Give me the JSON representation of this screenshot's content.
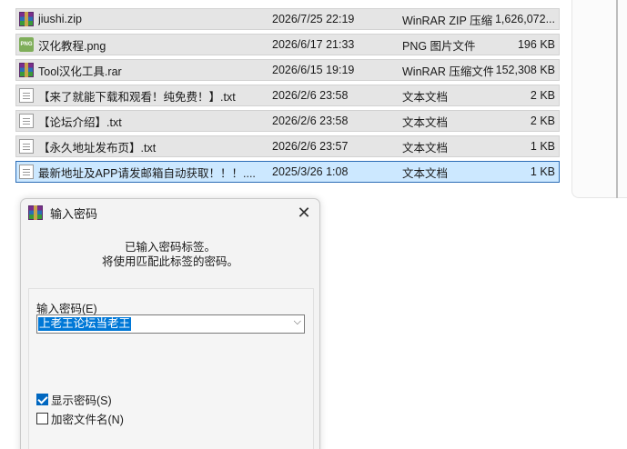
{
  "files": [
    {
      "name": "jiushi.zip",
      "date": "2026/7/25 22:19",
      "type": "WinRAR ZIP 压缩...",
      "size": "1,626,072...",
      "icon": "rar-archive-icon",
      "selected": false
    },
    {
      "name": "汉化教程.png",
      "date": "2026/6/17 21:33",
      "type": "PNG 图片文件",
      "size": "196 KB",
      "icon": "png-image-icon",
      "selected": false
    },
    {
      "name": "Tool汉化工具.rar",
      "date": "2026/6/15 19:19",
      "type": "WinRAR 压缩文件",
      "size": "152,308 KB",
      "icon": "rar-archive-icon",
      "selected": false
    },
    {
      "name": "【来了就能下载和观看！纯免费！】.txt",
      "date": "2026/2/6 23:58",
      "type": "文本文档",
      "size": "2 KB",
      "icon": "text-file-icon",
      "selected": false
    },
    {
      "name": "【论坛介绍】.txt",
      "date": "2026/2/6 23:58",
      "type": "文本文档",
      "size": "2 KB",
      "icon": "text-file-icon",
      "selected": false
    },
    {
      "name": "【永久地址发布页】.txt",
      "date": "2026/2/6 23:57",
      "type": "文本文档",
      "size": "1 KB",
      "icon": "text-file-icon",
      "selected": false
    },
    {
      "name": "最新地址及APP请发邮箱自动获取！！！....",
      "date": "2025/3/26 1:08",
      "type": "文本文档",
      "size": "1 KB",
      "icon": "text-file-icon",
      "selected": true
    }
  ],
  "dialog": {
    "title": "输入密码",
    "message_line1": "已输入密码标签。",
    "message_line2": "将使用匹配此标签的密码。",
    "password_label": "输入密码(E)",
    "password_value": "上老王论坛当老王",
    "show_password_label": "显示密码(S)",
    "show_password_checked": true,
    "encrypt_names_label": "加密文件名(N)",
    "encrypt_names_checked": false,
    "close_glyph": "✕",
    "dropdown_glyph": "⌵",
    "png_icon_text": "PNG"
  },
  "colors": {
    "row_background": "#e5e5e5",
    "selected_row_background": "#cce8ff",
    "selected_row_border": "#2b6cb5",
    "accent": "#0078d7"
  }
}
